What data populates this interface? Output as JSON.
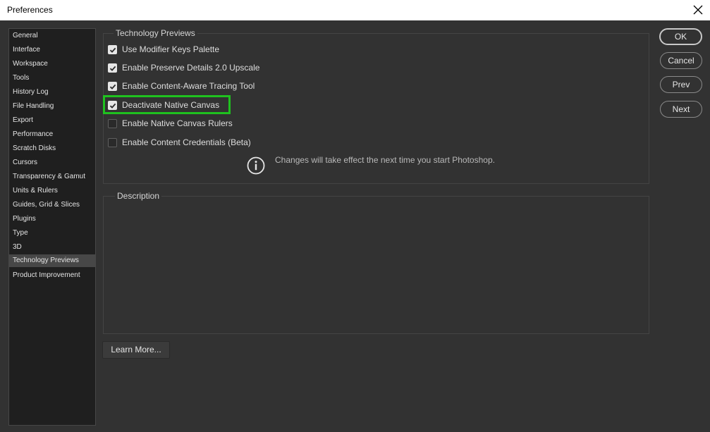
{
  "window": {
    "title": "Preferences",
    "close_icon": "close-icon"
  },
  "sidebar": {
    "items": [
      {
        "label": "General"
      },
      {
        "label": "Interface"
      },
      {
        "label": "Workspace"
      },
      {
        "label": "Tools"
      },
      {
        "label": "History Log"
      },
      {
        "label": "File Handling"
      },
      {
        "label": "Export"
      },
      {
        "label": "Performance"
      },
      {
        "label": "Scratch Disks"
      },
      {
        "label": "Cursors"
      },
      {
        "label": "Transparency & Gamut"
      },
      {
        "label": "Units & Rulers"
      },
      {
        "label": "Guides, Grid & Slices"
      },
      {
        "label": "Plugins"
      },
      {
        "label": "Type"
      },
      {
        "label": "3D"
      },
      {
        "label": "Technology Previews",
        "selected": true
      },
      {
        "label": "Product Improvement"
      }
    ]
  },
  "tech_previews": {
    "group_label": "Technology Previews",
    "options": [
      {
        "label": "Use Modifier Keys Palette",
        "checked": true
      },
      {
        "label": "Enable Preserve Details 2.0 Upscale",
        "checked": true
      },
      {
        "label": "Enable Content-Aware Tracing Tool",
        "checked": true
      },
      {
        "label": "Deactivate Native Canvas",
        "checked": true,
        "highlighted": true,
        "highlight_color": "#1fc11f"
      },
      {
        "label": "Enable Native Canvas Rulers",
        "checked": false
      },
      {
        "label": "Enable Content Credentials (Beta)",
        "checked": false
      }
    ],
    "info_text": "Changes will take effect the next time you start Photoshop."
  },
  "description": {
    "group_label": "Description"
  },
  "learn_more_label": "Learn More...",
  "buttons": {
    "ok": "OK",
    "cancel": "Cancel",
    "prev": "Prev",
    "next": "Next"
  },
  "colors": {
    "background": "#323232",
    "sidebar_bg": "#1f1f1f",
    "selected_bg": "#474747",
    "highlight": "#1fc11f"
  }
}
